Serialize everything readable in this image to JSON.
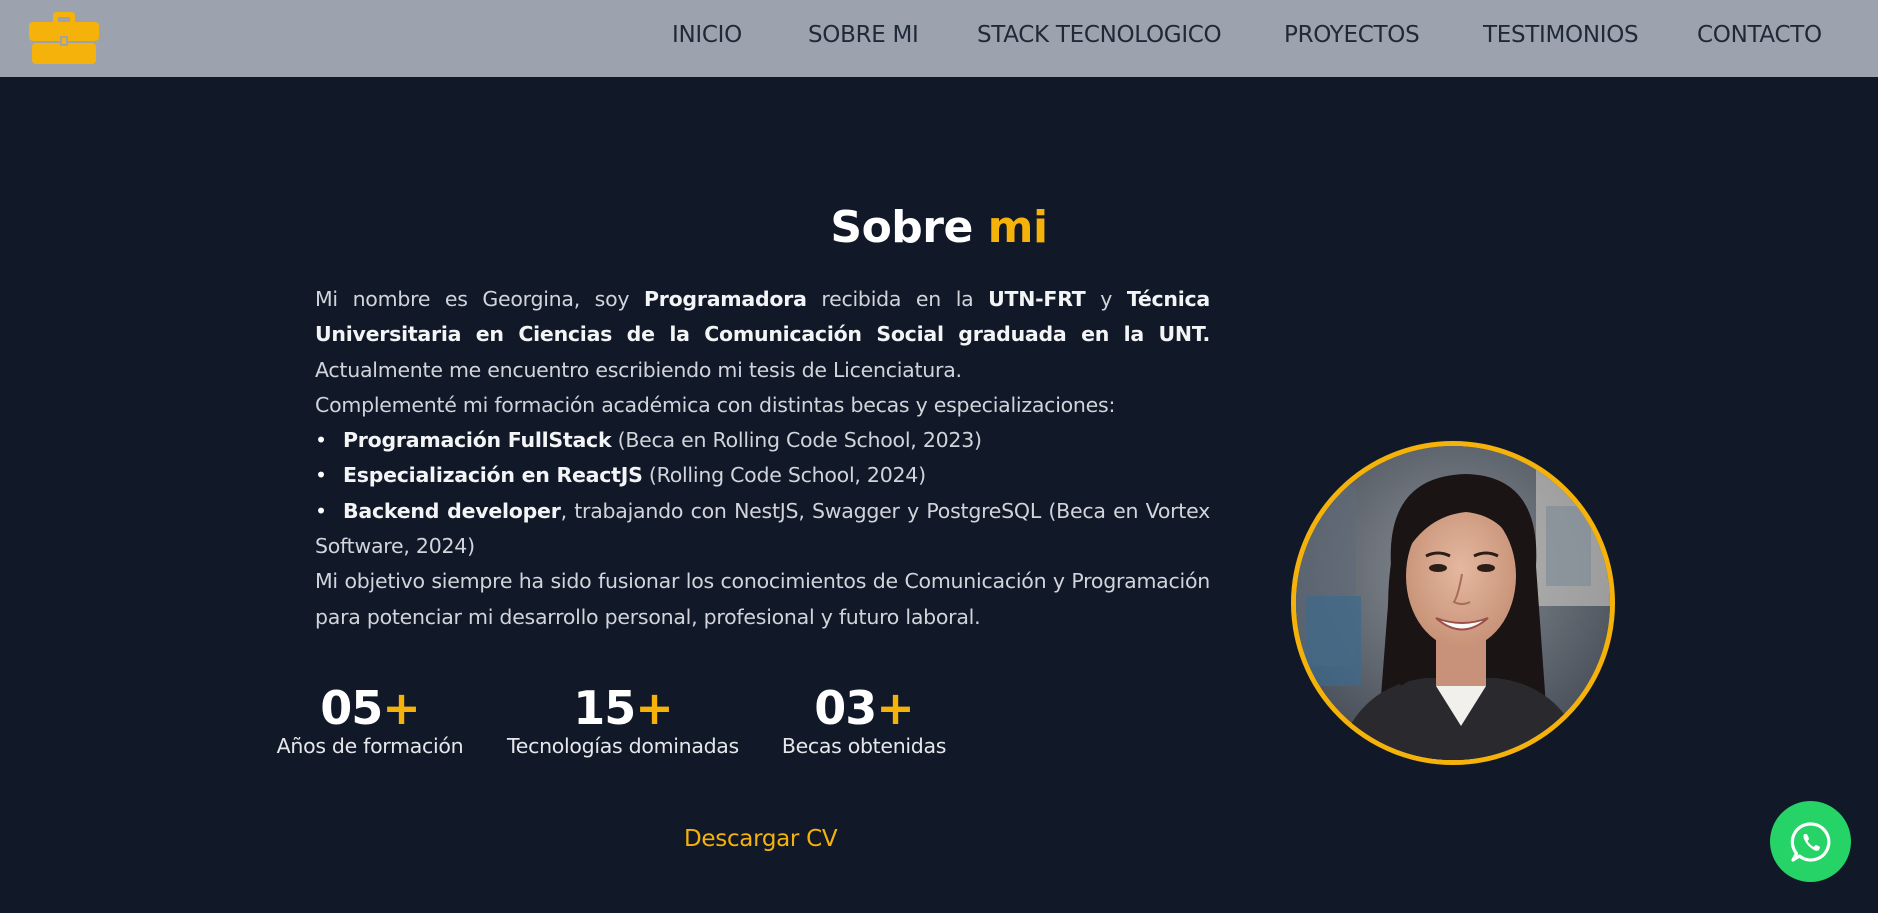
{
  "nav": {
    "logo_icon": "briefcase-icon",
    "items": [
      {
        "label": "INICIO"
      },
      {
        "label": "SOBRE MI"
      },
      {
        "label": "STACK TECNOLOGICO"
      },
      {
        "label": "PROYECTOS"
      },
      {
        "label": "TESTIMONIOS"
      },
      {
        "label": "CONTACTO"
      }
    ]
  },
  "about": {
    "title_main": "Sobre",
    "title_accent": "mi",
    "p1": {
      "t1": "Mi nombre es Georgina, soy ",
      "b1": "Programadora",
      "t2": " recibida en la ",
      "b2": "UTN-FRT",
      "t3": " y ",
      "b3": "Técnica Universitaria en Ciencias de la Comunicación Social graduada en la UNT.",
      "t4": " Actualmente me encuentro escribiendo mi tesis de Licenciatura."
    },
    "p2": "Complementé mi formación académica con distintas becas y especializaciones:",
    "bullets": [
      {
        "bold": "Programación FullStack",
        "text": " (Beca en Rolling Code School, 2023)"
      },
      {
        "bold": "Especialización en ReactJS",
        "text": " (Rolling Code School, 2024)"
      },
      {
        "bold": "Backend developer",
        "text": ", trabajando con NestJS, Swagger y PostgreSQL (Beca en Vortex Software, 2024)"
      }
    ],
    "bullet_char": "•",
    "p3": "Mi objetivo siempre ha sido fusionar los conocimientos de Comunicación y Programación para potenciar mi desarrollo personal, profesional y futuro laboral."
  },
  "stats": [
    {
      "number": "05",
      "suffix": "+",
      "label": "Años de formación"
    },
    {
      "number": "15",
      "suffix": "+",
      "label": "Tecnologías dominadas"
    },
    {
      "number": "03",
      "suffix": "+",
      "label": "Becas obtenidas"
    }
  ],
  "cv_button": "Descargar CV",
  "profile_photo": "profile-photo",
  "whatsapp_icon": "whatsapp-icon",
  "colors": {
    "accent": "#f5b20a",
    "background": "#111827",
    "navbar": "#9ca3af",
    "whatsapp": "#25d366"
  }
}
